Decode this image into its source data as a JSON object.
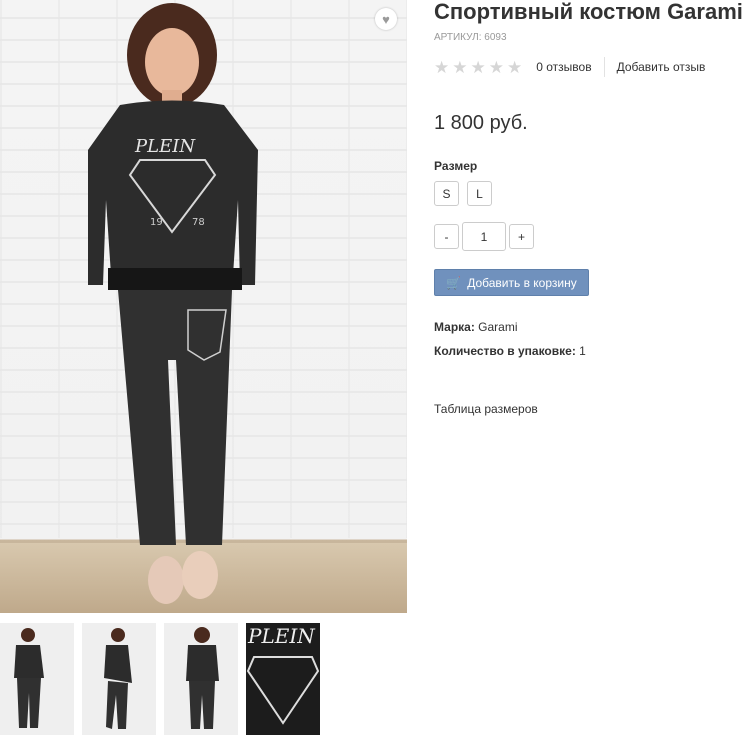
{
  "product": {
    "title": "Спортивный костюм Garami",
    "sku": "АРТИКУЛ: 6093",
    "rating": {
      "stars": 5,
      "filled": 0,
      "reviews_count": "0 отзывов",
      "add_review": "Добавить отзыв"
    },
    "price": "1 800 руб.",
    "size_label": "Размер",
    "sizes": [
      "S",
      "L"
    ],
    "quantity": {
      "minus": "-",
      "value": "1",
      "plus": "+"
    },
    "add_to_cart": "Добавить в корзину",
    "brand": {
      "label": "Марка:",
      "value": "Garami"
    },
    "pack": {
      "label": "Количество в упаковке:",
      "value": "1"
    },
    "size_table_link": "Таблица размеров"
  },
  "icons": {
    "favorite": "heart-icon",
    "cart": "cart-icon",
    "star": "star-icon"
  },
  "colors": {
    "accent_button": "#7091bd",
    "star_empty": "#d6d6d6"
  }
}
